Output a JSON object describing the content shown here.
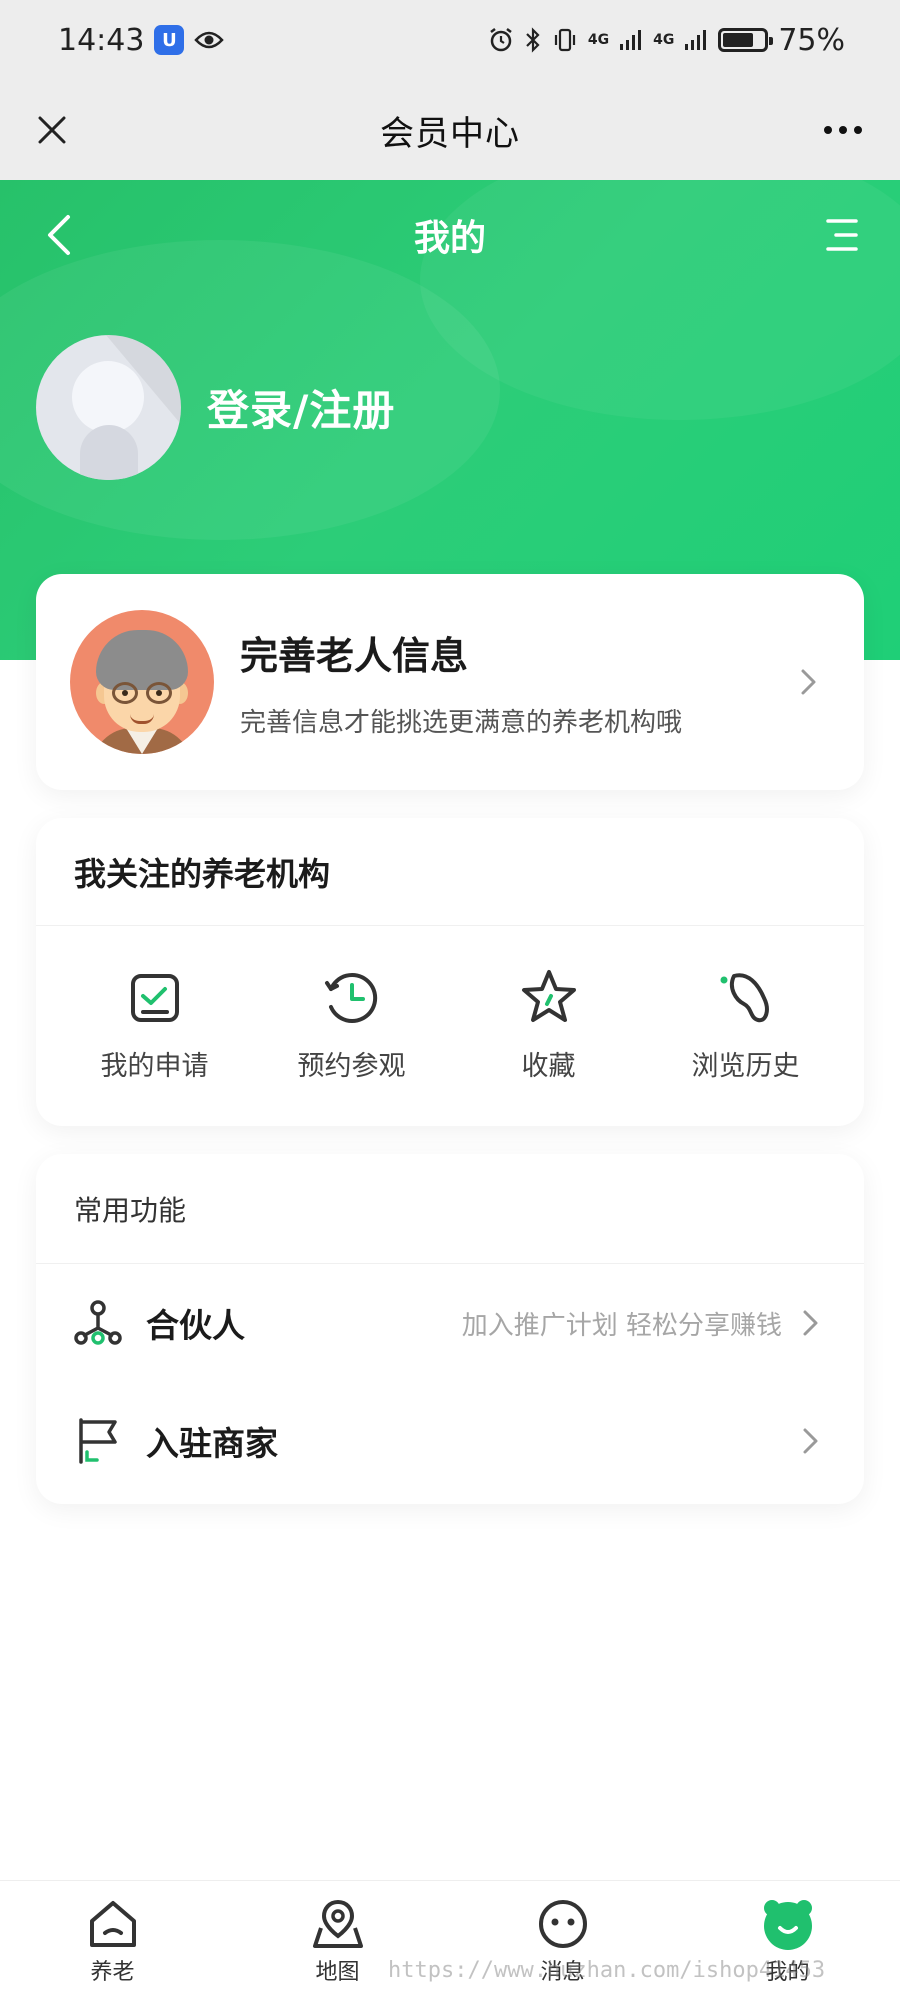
{
  "status_bar": {
    "time": "14:43",
    "battery_text": "75%",
    "battery_level": 0.75,
    "network_1": "4G",
    "network_2": "4G"
  },
  "title_bar": {
    "title": "会员中心"
  },
  "header": {
    "title": "我的",
    "login_label": "登录/注册",
    "brand_color": "#27c16a"
  },
  "elder_card": {
    "title": "完善老人信息",
    "subtitle": "完善信息才能挑选更满意的养老机构哦"
  },
  "follow_card": {
    "title": "我关注的养老机构",
    "items": [
      {
        "label": "我的申请",
        "icon": "application-check-icon"
      },
      {
        "label": "预约参观",
        "icon": "clock-icon"
      },
      {
        "label": "收藏",
        "icon": "star-icon"
      },
      {
        "label": "浏览历史",
        "icon": "footprint-icon"
      }
    ]
  },
  "common_card": {
    "title": "常用功能",
    "rows": [
      {
        "label": "合伙人",
        "hint": "加入推广计划 轻松分享赚钱",
        "icon": "partner-network-icon"
      },
      {
        "label": "入驻商家",
        "hint": "",
        "icon": "flag-icon"
      }
    ]
  },
  "tab_bar": {
    "tabs": [
      {
        "label": "养老",
        "icon": "home-icon"
      },
      {
        "label": "地图",
        "icon": "map-pin-icon"
      },
      {
        "label": "消息",
        "icon": "message-face-icon"
      },
      {
        "label": "我的",
        "icon": "profile-active-icon"
      }
    ],
    "active_index": 3
  },
  "watermark": "https://www.huzhan.com/ishop41453"
}
